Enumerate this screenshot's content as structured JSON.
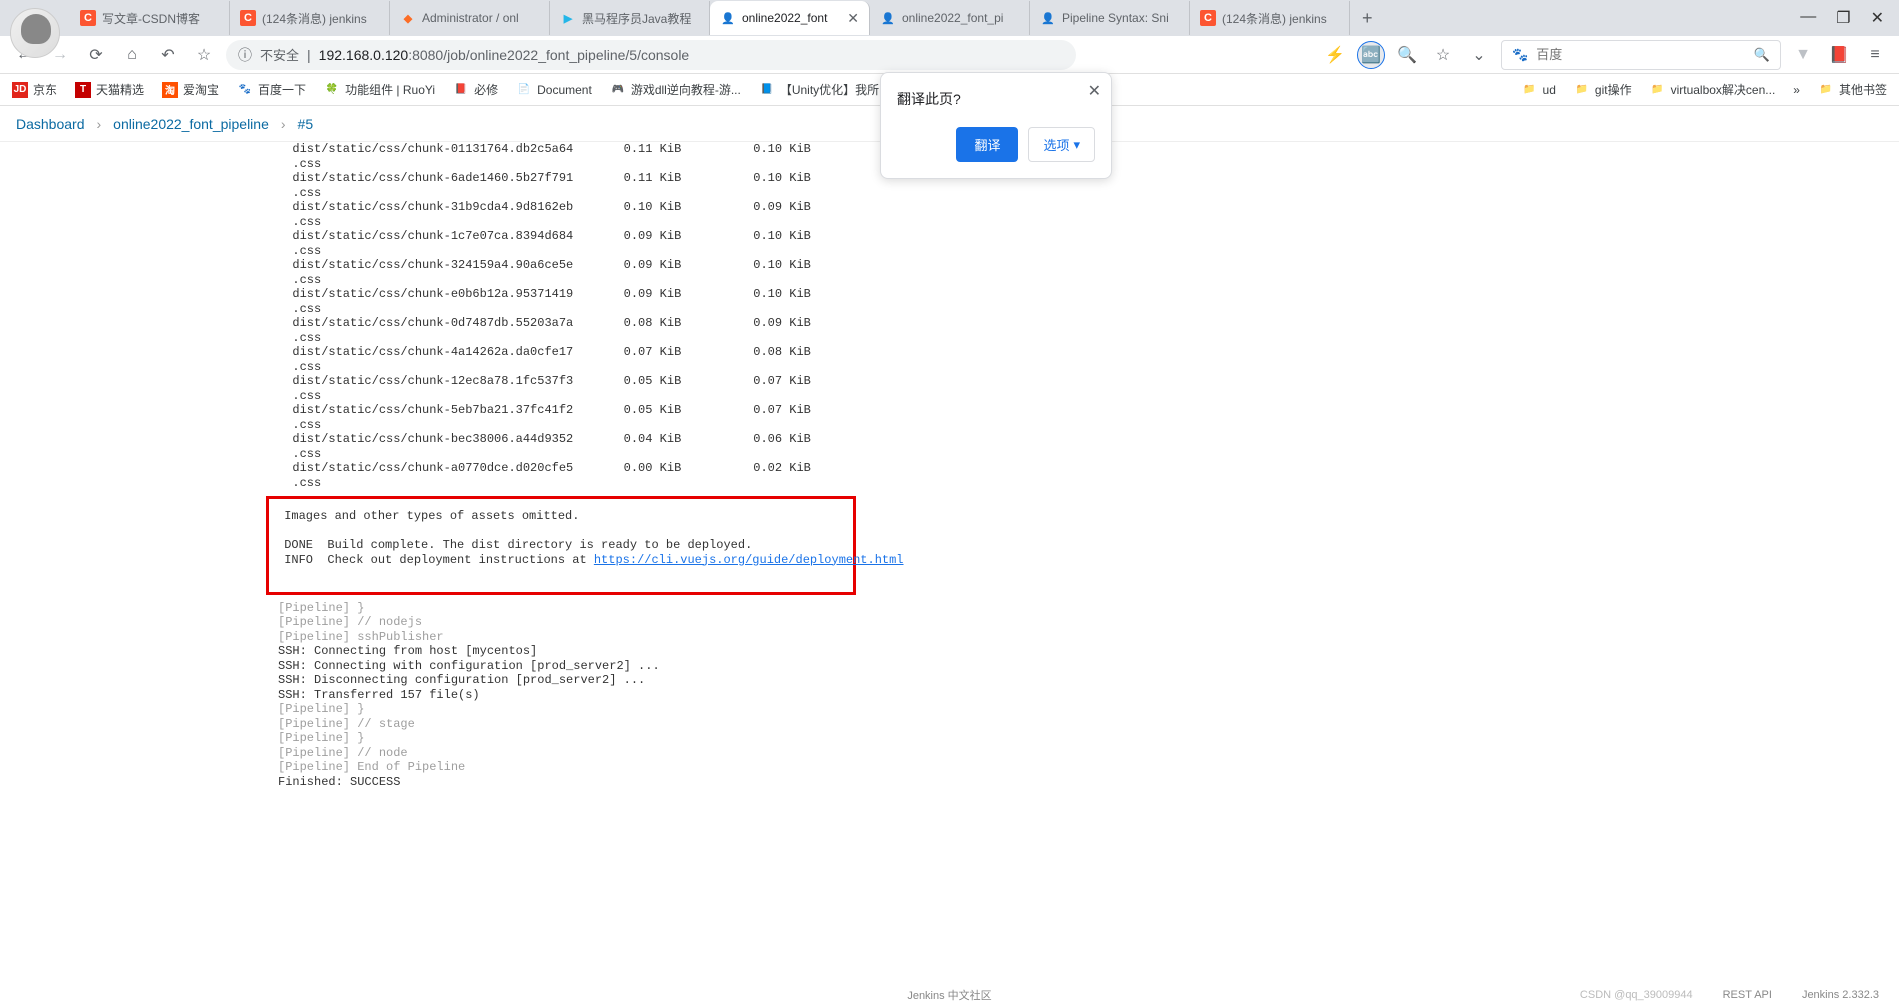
{
  "tabs": [
    {
      "favicon": "C",
      "title": "写文章-CSDN博客"
    },
    {
      "favicon": "C",
      "title": "(124条消息) jenkins"
    },
    {
      "favicon": "gitlab",
      "title": "Administrator / onl"
    },
    {
      "favicon": "blue",
      "title": "黑马程序员Java教程"
    },
    {
      "favicon": "jenkins",
      "title": "online2022_font"
    },
    {
      "favicon": "jenkins",
      "title": "online2022_font_pi"
    },
    {
      "favicon": "jenkins",
      "title": "Pipeline Syntax: Sni"
    },
    {
      "favicon": "C",
      "title": "(124条消息) jenkins"
    }
  ],
  "address": {
    "insecure_label": "不安全",
    "host": "192.168.0.120",
    "port": ":8080",
    "path": "/job/online2022_font_pipeline/5/console"
  },
  "search": {
    "placeholder": "百度",
    "icon": "🔍"
  },
  "bookmarks": [
    {
      "icon": "JD",
      "cls": "bi-jd",
      "label": "京东"
    },
    {
      "icon": "T",
      "cls": "bi-tm",
      "label": "天猫精选"
    },
    {
      "icon": "淘",
      "cls": "bi-atb",
      "label": "爱淘宝"
    },
    {
      "icon": "🐾",
      "cls": "bi-bd",
      "label": "百度一下"
    },
    {
      "icon": "🍀",
      "cls": "",
      "label": "功能组件 | RuoYi"
    },
    {
      "icon": "📕",
      "cls": "",
      "label": "必修"
    },
    {
      "icon": "📄",
      "cls": "",
      "label": "Document"
    },
    {
      "icon": "🎮",
      "cls": "",
      "label": "游戏dll逆向教程-游..."
    },
    {
      "icon": "📘",
      "cls": "",
      "label": "【Unity优化】我所..."
    }
  ],
  "bookmarks_right": [
    {
      "label": "ud"
    },
    {
      "label": "git操作"
    },
    {
      "label": "virtualbox解决cen..."
    },
    {
      "label": "»"
    },
    {
      "label": "其他书签"
    }
  ],
  "breadcrumb": {
    "dashboard": "Dashboard",
    "job": "online2022_font_pipeline",
    "build": "#5"
  },
  "translate": {
    "title": "翻译此页?",
    "primary": "翻译",
    "secondary": "选项"
  },
  "files": [
    {
      "name": "dist/static/css/chunk-01131764.db2c5a64.css",
      "s1": "0.11 KiB",
      "s2": "0.10 KiB"
    },
    {
      "name": "dist/static/css/chunk-6ade1460.5b27f791.css",
      "s1": "0.11 KiB",
      "s2": "0.10 KiB"
    },
    {
      "name": "dist/static/css/chunk-31b9cda4.9d8162eb.css",
      "s1": "0.10 KiB",
      "s2": "0.09 KiB"
    },
    {
      "name": "dist/static/css/chunk-1c7e07ca.8394d684.css",
      "s1": "0.09 KiB",
      "s2": "0.10 KiB"
    },
    {
      "name": "dist/static/css/chunk-324159a4.90a6ce5e.css",
      "s1": "0.09 KiB",
      "s2": "0.10 KiB"
    },
    {
      "name": "dist/static/css/chunk-e0b6b12a.95371419.css",
      "s1": "0.09 KiB",
      "s2": "0.10 KiB"
    },
    {
      "name": "dist/static/css/chunk-0d7487db.55203a7a.css",
      "s1": "0.08 KiB",
      "s2": "0.09 KiB"
    },
    {
      "name": "dist/static/css/chunk-4a14262a.da0cfe17.css",
      "s1": "0.07 KiB",
      "s2": "0.08 KiB"
    },
    {
      "name": "dist/static/css/chunk-12ec8a78.1fc537f3.css",
      "s1": "0.05 KiB",
      "s2": "0.07 KiB"
    },
    {
      "name": "dist/static/css/chunk-5eb7ba21.37fc41f2.css",
      "s1": "0.05 KiB",
      "s2": "0.07 KiB"
    },
    {
      "name": "dist/static/css/chunk-bec38006.a44d9352.css",
      "s1": "0.04 KiB",
      "s2": "0.06 KiB"
    },
    {
      "name": "dist/static/css/chunk-a0770dce.d020cfe5.css",
      "s1": "0.00 KiB",
      "s2": "0.02 KiB"
    }
  ],
  "redbox": {
    "l1": " Images and other types of assets omitted.",
    "l2": " DONE  Build complete. The dist directory is ready to be deployed.",
    "l3": " INFO  Check out deployment instructions at ",
    "link": "https://cli.vuejs.org/guide/deployment.html"
  },
  "pipeline": [
    {
      "cls": "pipeline-line",
      "text": "[Pipeline] }"
    },
    {
      "cls": "pipeline-line",
      "text": "[Pipeline] // nodejs"
    },
    {
      "cls": "pipeline-line",
      "text": "[Pipeline] sshPublisher"
    },
    {
      "cls": "ssh-line",
      "text": "SSH: Connecting from host [mycentos]"
    },
    {
      "cls": "ssh-line",
      "text": "SSH: Connecting with configuration [prod_server2] ..."
    },
    {
      "cls": "ssh-line",
      "text": "SSH: Disconnecting configuration [prod_server2] ..."
    },
    {
      "cls": "ssh-line",
      "text": "SSH: Transferred 157 file(s)"
    },
    {
      "cls": "pipeline-line",
      "text": "[Pipeline] }"
    },
    {
      "cls": "pipeline-line",
      "text": "[Pipeline] // stage"
    },
    {
      "cls": "pipeline-line",
      "text": "[Pipeline] }"
    },
    {
      "cls": "pipeline-line",
      "text": "[Pipeline] // node"
    },
    {
      "cls": "pipeline-line",
      "text": "[Pipeline] End of Pipeline"
    },
    {
      "cls": "ssh-line",
      "text": "Finished: SUCCESS"
    }
  ],
  "footer": {
    "watermark": "CSDN @qq_39009944",
    "center": "Jenkins 中文社区",
    "left": "REST API",
    "right": "Jenkins 2.332.3"
  }
}
